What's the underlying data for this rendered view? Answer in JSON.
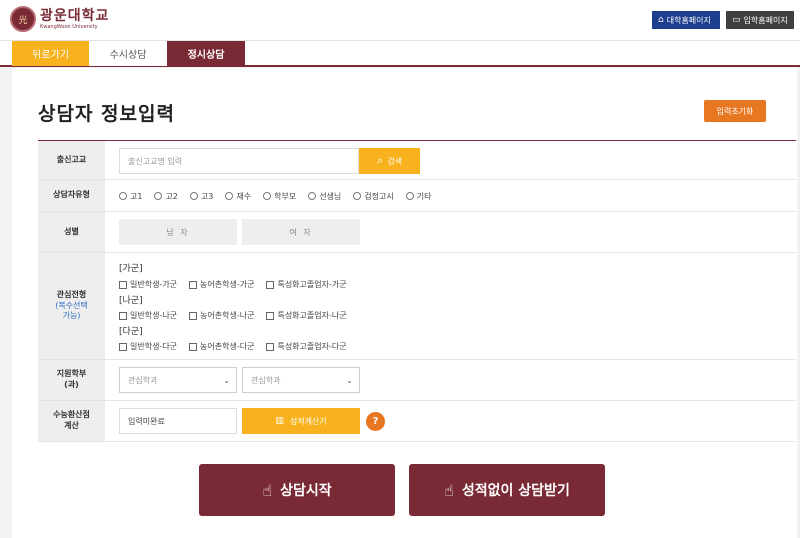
{
  "header": {
    "logo_mark": "光",
    "logo_kr": "광운대학교",
    "logo_en": "KwangWoon University",
    "univ_home_label": "대학홈페이지",
    "admission_home_label": "입학홈페이지"
  },
  "tabs": {
    "back": "뒤로가기",
    "susi": "수시상담",
    "jeongsi": "정시상담"
  },
  "page": {
    "title": "상담자 정보입력",
    "reset_label": "입력초기화"
  },
  "form": {
    "school": {
      "label": "출신고교",
      "placeholder": "출신고교명 입력",
      "search_label": "검색"
    },
    "type": {
      "label": "상담자유형",
      "options": [
        "고1",
        "고2",
        "고3",
        "재수",
        "학부모",
        "선생님",
        "검정고시",
        "기타"
      ]
    },
    "gender": {
      "label": "성별",
      "male": "남 자",
      "female": "여 자"
    },
    "interest": {
      "label": "관심전형",
      "sub": "(복수선택",
      "sub2": "가능)",
      "groups": [
        {
          "name": "[가군]",
          "options": [
            "일반학생-가군",
            "농어촌학생-가군",
            "특성화고졸업자-가군"
          ]
        },
        {
          "name": "[나군]",
          "options": [
            "일반학생-나군",
            "농어촌학생-나군",
            "특성화고졸업자-나군"
          ]
        },
        {
          "name": "[다군]",
          "options": [
            "일반학생-다군",
            "농어촌학생-다군",
            "특성화고졸업자-다군"
          ]
        }
      ]
    },
    "dept": {
      "label": "지원학부",
      "label2": "(과)",
      "select1": "관심학과",
      "select2": "관심학과"
    },
    "score": {
      "label": "수능환산점",
      "label2": "계산",
      "status": "입력미완료",
      "calc_label": "성적계산기",
      "help": "?"
    }
  },
  "actions": {
    "start": "상담시작",
    "no_grade": "성적없이 상담받기"
  },
  "colors": {
    "brand": "#7a2a35",
    "accent_yellow": "#f7b21e",
    "accent_orange": "#e87722",
    "univ_blue": "#1d3d8f"
  }
}
